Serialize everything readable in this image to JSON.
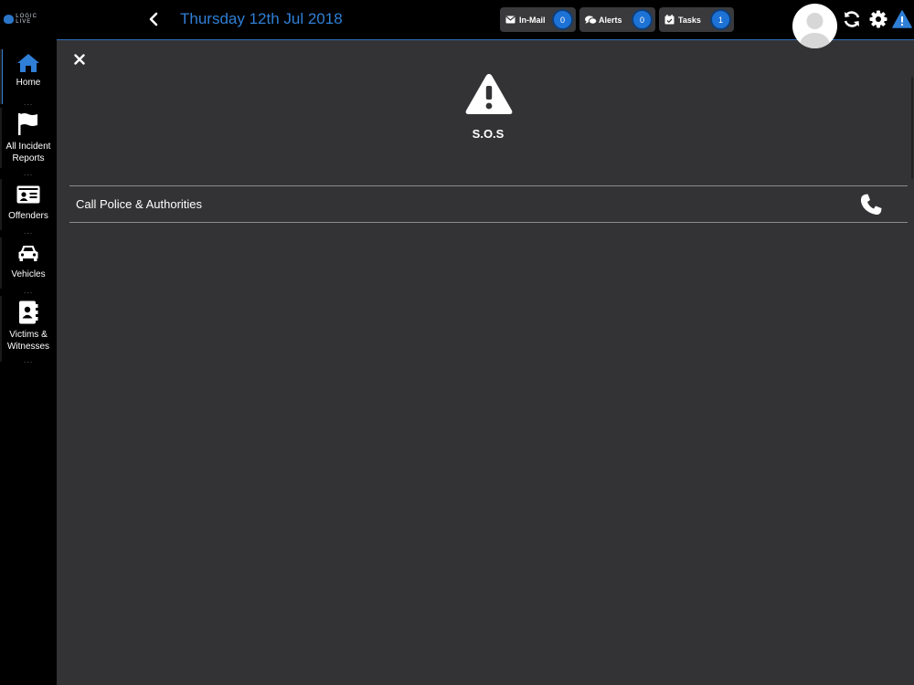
{
  "header": {
    "logo_text": "LOGIC LIVE",
    "date": "Thursday 12th Jul 2018",
    "badges": [
      {
        "label": "In-Mail",
        "count": "0",
        "icon": "envelope-icon"
      },
      {
        "label": "Alerts",
        "count": "0",
        "icon": "chat-bubbles-icon"
      },
      {
        "label": "Tasks",
        "count": "1",
        "icon": "calendar-check-icon"
      }
    ],
    "actions": [
      "sync-icon",
      "gear-icon",
      "warning-icon"
    ]
  },
  "sidebar": {
    "items": [
      {
        "label": "Home",
        "icon": "home-icon",
        "active": true
      },
      {
        "label": "All Incident Reports",
        "icon": "flag-icon"
      },
      {
        "label": "Offenders",
        "icon": "id-card-icon"
      },
      {
        "label": "Vehicles",
        "icon": "car-icon"
      },
      {
        "label": "Victims & Witnesses",
        "icon": "contact-book-icon"
      }
    ],
    "dots": "..."
  },
  "panel": {
    "close_icon": "close-icon",
    "sos_icon": "warning-triangle-icon",
    "title": "S.O.S",
    "options": [
      {
        "label": "Call Police & Authorities",
        "icon": "phone-icon"
      }
    ]
  },
  "colors": {
    "accent": "#2f7fd6",
    "panel_bg": "#333335",
    "badge_bg": "#1d72d6"
  }
}
